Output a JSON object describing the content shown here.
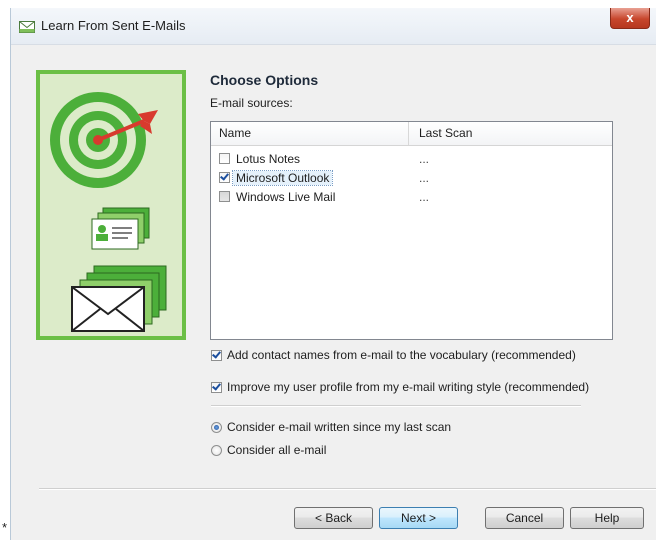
{
  "window": {
    "title": "Learn From Sent E-Mails",
    "close_label": "x"
  },
  "main": {
    "heading": "Choose Options",
    "sources_label": "E-mail sources:",
    "list": {
      "columns": [
        "Name",
        "Last Scan"
      ],
      "rows": [
        {
          "name": "Lotus Notes",
          "last_scan": "...",
          "checked": false,
          "disabled": false
        },
        {
          "name": "Microsoft Outlook",
          "last_scan": "...",
          "checked": true,
          "selected": true
        },
        {
          "name": "Windows Live Mail",
          "last_scan": "...",
          "checked": false,
          "disabled": true
        }
      ]
    },
    "options": {
      "add_contacts": "Add contact names from e-mail to the vocabulary (recommended)",
      "improve_profile": "Improve my user profile from my e-mail writing style (recommended)",
      "since_last_scan": "Consider e-mail written since my last scan",
      "all_email": "Consider all e-mail"
    }
  },
  "buttons": {
    "back": "< Back",
    "next": "Next >",
    "cancel": "Cancel",
    "help": "Help"
  },
  "footer_mark": "*",
  "colors": {
    "accent_green": "#6bbf45",
    "panel_green": "#dcebc9",
    "target_green": "#4caf3a",
    "dart_red": "#d83a2e",
    "close_red": "#c7462c"
  }
}
